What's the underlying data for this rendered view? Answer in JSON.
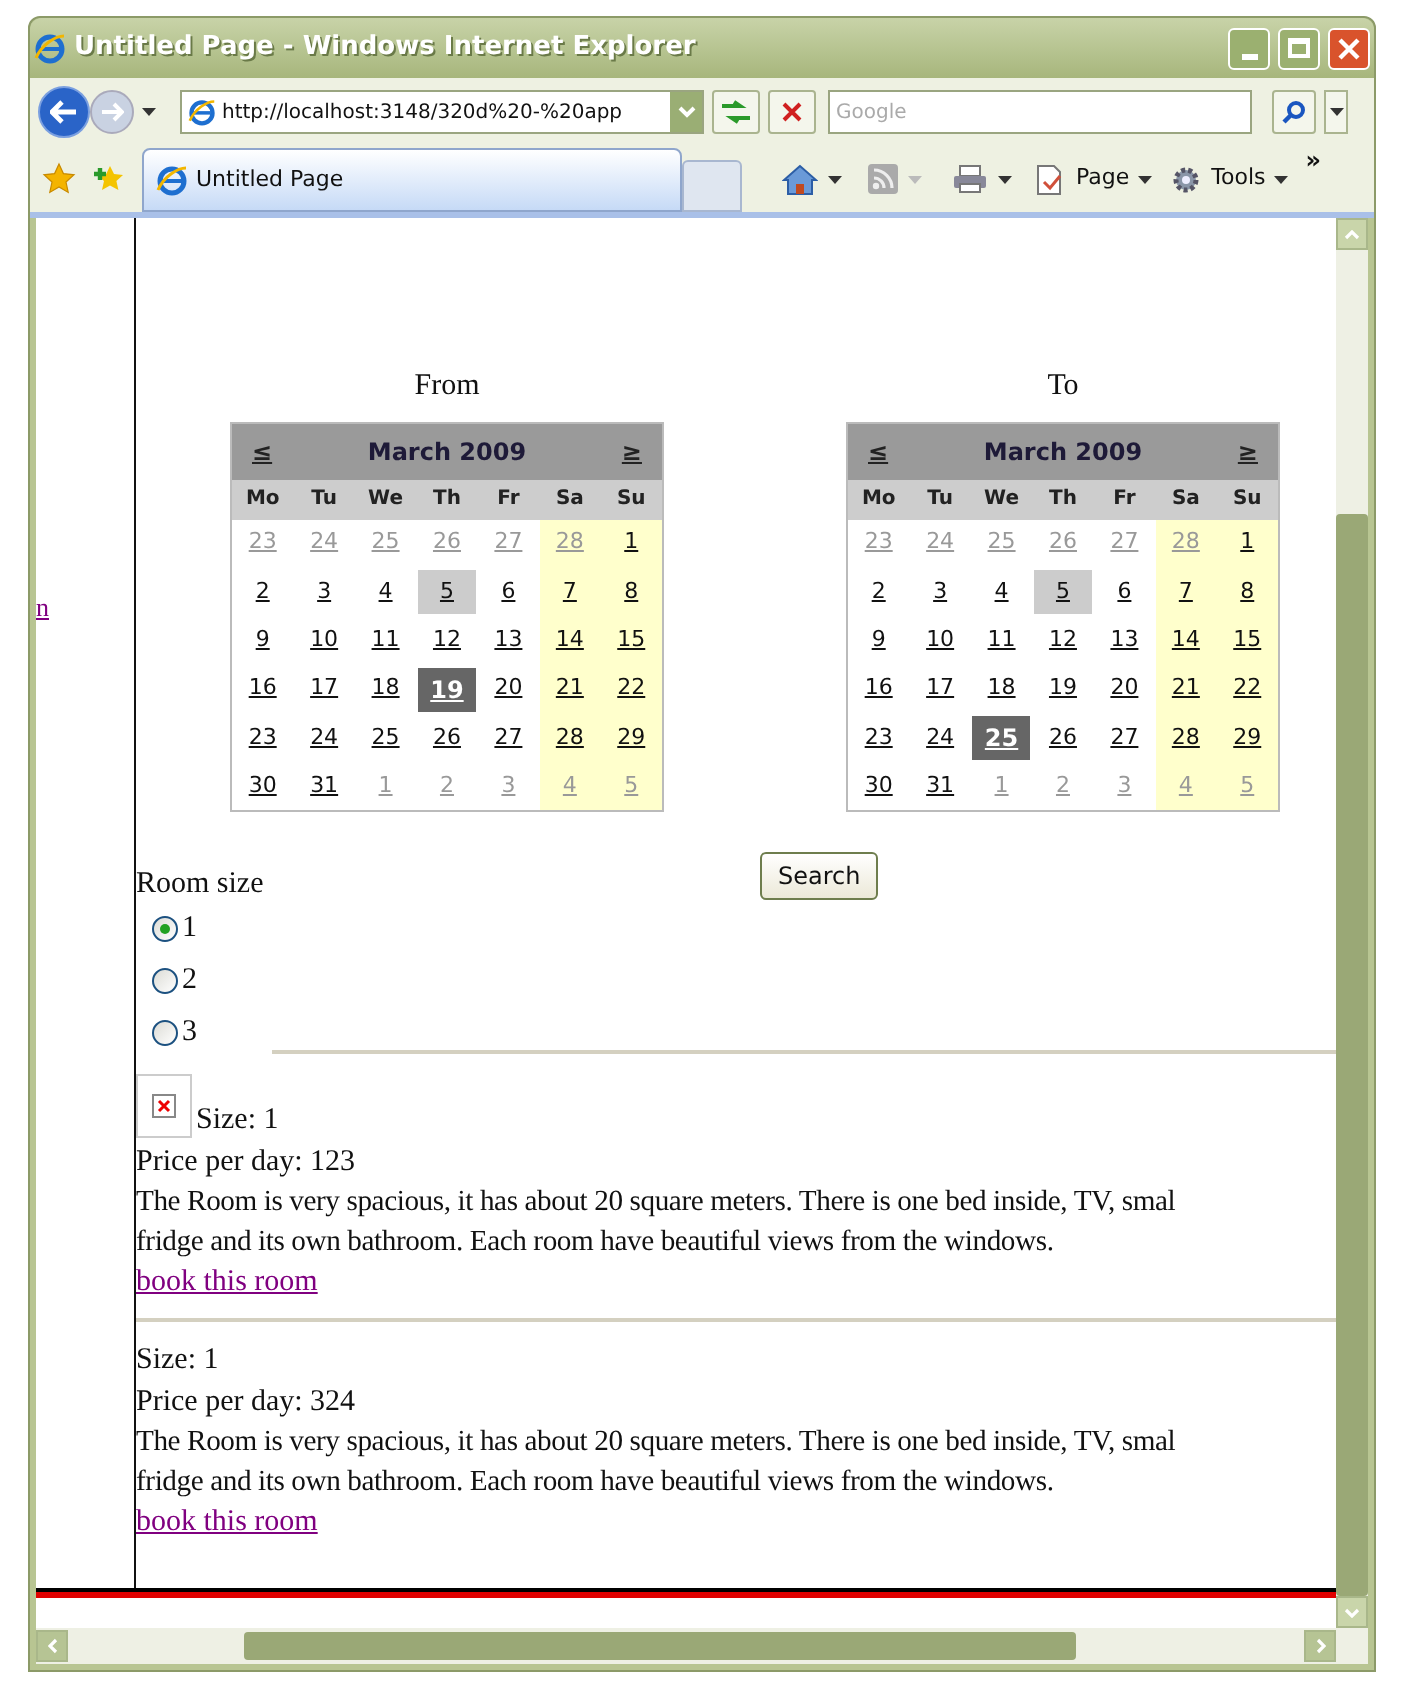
{
  "window": {
    "title": "Untitled Page - Windows Internet Explorer"
  },
  "address_bar": {
    "url": "http://localhost:3148/320d%20-%20app"
  },
  "search_box": {
    "placeholder": "Google"
  },
  "tabs": [
    {
      "label": "Untitled Page",
      "selected": true
    }
  ],
  "command_bar": {
    "items": [
      {
        "label": "Page"
      },
      {
        "label": "Tools"
      }
    ],
    "more": "»"
  },
  "left_nav": {
    "link": "n"
  },
  "calendars": [
    {
      "label": "From",
      "prev": "≤",
      "month": "March 2009",
      "next": "≥",
      "weekdays": [
        "Mo",
        "Tu",
        "We",
        "Th",
        "Fr",
        "Sa",
        "Su"
      ],
      "weeks": [
        [
          {
            "day": "23",
            "other_month": true,
            "today": false,
            "selected": false
          },
          {
            "day": "24",
            "other_month": true,
            "today": false,
            "selected": false
          },
          {
            "day": "25",
            "other_month": true,
            "today": false,
            "selected": false
          },
          {
            "day": "26",
            "other_month": true,
            "today": false,
            "selected": false
          },
          {
            "day": "27",
            "other_month": true,
            "today": false,
            "selected": false
          },
          {
            "day": "28",
            "other_month": true,
            "today": false,
            "selected": false
          },
          {
            "day": "1",
            "other_month": false,
            "today": false,
            "selected": false
          }
        ],
        [
          {
            "day": "2",
            "other_month": false,
            "today": false,
            "selected": false
          },
          {
            "day": "3",
            "other_month": false,
            "today": false,
            "selected": false
          },
          {
            "day": "4",
            "other_month": false,
            "today": false,
            "selected": false
          },
          {
            "day": "5",
            "other_month": false,
            "today": true,
            "selected": false
          },
          {
            "day": "6",
            "other_month": false,
            "today": false,
            "selected": false
          },
          {
            "day": "7",
            "other_month": false,
            "today": false,
            "selected": false
          },
          {
            "day": "8",
            "other_month": false,
            "today": false,
            "selected": false
          }
        ],
        [
          {
            "day": "9",
            "other_month": false,
            "today": false,
            "selected": false
          },
          {
            "day": "10",
            "other_month": false,
            "today": false,
            "selected": false
          },
          {
            "day": "11",
            "other_month": false,
            "today": false,
            "selected": false
          },
          {
            "day": "12",
            "other_month": false,
            "today": false,
            "selected": false
          },
          {
            "day": "13",
            "other_month": false,
            "today": false,
            "selected": false
          },
          {
            "day": "14",
            "other_month": false,
            "today": false,
            "selected": false
          },
          {
            "day": "15",
            "other_month": false,
            "today": false,
            "selected": false
          }
        ],
        [
          {
            "day": "16",
            "other_month": false,
            "today": false,
            "selected": false
          },
          {
            "day": "17",
            "other_month": false,
            "today": false,
            "selected": false
          },
          {
            "day": "18",
            "other_month": false,
            "today": false,
            "selected": false
          },
          {
            "day": "19",
            "other_month": false,
            "today": false,
            "selected": true
          },
          {
            "day": "20",
            "other_month": false,
            "today": false,
            "selected": false
          },
          {
            "day": "21",
            "other_month": false,
            "today": false,
            "selected": false
          },
          {
            "day": "22",
            "other_month": false,
            "today": false,
            "selected": false
          }
        ],
        [
          {
            "day": "23",
            "other_month": false,
            "today": false,
            "selected": false
          },
          {
            "day": "24",
            "other_month": false,
            "today": false,
            "selected": false
          },
          {
            "day": "25",
            "other_month": false,
            "today": false,
            "selected": false
          },
          {
            "day": "26",
            "other_month": false,
            "today": false,
            "selected": false
          },
          {
            "day": "27",
            "other_month": false,
            "today": false,
            "selected": false
          },
          {
            "day": "28",
            "other_month": false,
            "today": false,
            "selected": false
          },
          {
            "day": "29",
            "other_month": false,
            "today": false,
            "selected": false
          }
        ],
        [
          {
            "day": "30",
            "other_month": false,
            "today": false,
            "selected": false
          },
          {
            "day": "31",
            "other_month": false,
            "today": false,
            "selected": false
          },
          {
            "day": "1",
            "other_month": true,
            "today": false,
            "selected": false
          },
          {
            "day": "2",
            "other_month": true,
            "today": false,
            "selected": false
          },
          {
            "day": "3",
            "other_month": true,
            "today": false,
            "selected": false
          },
          {
            "day": "4",
            "other_month": true,
            "today": false,
            "selected": false
          },
          {
            "day": "5",
            "other_month": true,
            "today": false,
            "selected": false
          }
        ]
      ]
    },
    {
      "label": "To",
      "prev": "≤",
      "month": "March 2009",
      "next": "≥",
      "weekdays": [
        "Mo",
        "Tu",
        "We",
        "Th",
        "Fr",
        "Sa",
        "Su"
      ],
      "weeks": [
        [
          {
            "day": "23",
            "other_month": true,
            "today": false,
            "selected": false
          },
          {
            "day": "24",
            "other_month": true,
            "today": false,
            "selected": false
          },
          {
            "day": "25",
            "other_month": true,
            "today": false,
            "selected": false
          },
          {
            "day": "26",
            "other_month": true,
            "today": false,
            "selected": false
          },
          {
            "day": "27",
            "other_month": true,
            "today": false,
            "selected": false
          },
          {
            "day": "28",
            "other_month": true,
            "today": false,
            "selected": false
          },
          {
            "day": "1",
            "other_month": false,
            "today": false,
            "selected": false
          }
        ],
        [
          {
            "day": "2",
            "other_month": false,
            "today": false,
            "selected": false
          },
          {
            "day": "3",
            "other_month": false,
            "today": false,
            "selected": false
          },
          {
            "day": "4",
            "other_month": false,
            "today": false,
            "selected": false
          },
          {
            "day": "5",
            "other_month": false,
            "today": true,
            "selected": false
          },
          {
            "day": "6",
            "other_month": false,
            "today": false,
            "selected": false
          },
          {
            "day": "7",
            "other_month": false,
            "today": false,
            "selected": false
          },
          {
            "day": "8",
            "other_month": false,
            "today": false,
            "selected": false
          }
        ],
        [
          {
            "day": "9",
            "other_month": false,
            "today": false,
            "selected": false
          },
          {
            "day": "10",
            "other_month": false,
            "today": false,
            "selected": false
          },
          {
            "day": "11",
            "other_month": false,
            "today": false,
            "selected": false
          },
          {
            "day": "12",
            "other_month": false,
            "today": false,
            "selected": false
          },
          {
            "day": "13",
            "other_month": false,
            "today": false,
            "selected": false
          },
          {
            "day": "14",
            "other_month": false,
            "today": false,
            "selected": false
          },
          {
            "day": "15",
            "other_month": false,
            "today": false,
            "selected": false
          }
        ],
        [
          {
            "day": "16",
            "other_month": false,
            "today": false,
            "selected": false
          },
          {
            "day": "17",
            "other_month": false,
            "today": false,
            "selected": false
          },
          {
            "day": "18",
            "other_month": false,
            "today": false,
            "selected": false
          },
          {
            "day": "19",
            "other_month": false,
            "today": false,
            "selected": false
          },
          {
            "day": "20",
            "other_month": false,
            "today": false,
            "selected": false
          },
          {
            "day": "21",
            "other_month": false,
            "today": false,
            "selected": false
          },
          {
            "day": "22",
            "other_month": false,
            "today": false,
            "selected": false
          }
        ],
        [
          {
            "day": "23",
            "other_month": false,
            "today": false,
            "selected": false
          },
          {
            "day": "24",
            "other_month": false,
            "today": false,
            "selected": false
          },
          {
            "day": "25",
            "other_month": false,
            "today": false,
            "selected": true
          },
          {
            "day": "26",
            "other_month": false,
            "today": false,
            "selected": false
          },
          {
            "day": "27",
            "other_month": false,
            "today": false,
            "selected": false
          },
          {
            "day": "28",
            "other_month": false,
            "today": false,
            "selected": false
          },
          {
            "day": "29",
            "other_month": false,
            "today": false,
            "selected": false
          }
        ],
        [
          {
            "day": "30",
            "other_month": false,
            "today": false,
            "selected": false
          },
          {
            "day": "31",
            "other_month": false,
            "today": false,
            "selected": false
          },
          {
            "day": "1",
            "other_month": true,
            "today": false,
            "selected": false
          },
          {
            "day": "2",
            "other_month": true,
            "today": false,
            "selected": false
          },
          {
            "day": "3",
            "other_month": true,
            "today": false,
            "selected": false
          },
          {
            "day": "4",
            "other_month": true,
            "today": false,
            "selected": false
          },
          {
            "day": "5",
            "other_month": true,
            "today": false,
            "selected": false
          }
        ]
      ]
    }
  ],
  "room_size": {
    "label": "Room size",
    "options": [
      {
        "label": "1",
        "selected": true
      },
      {
        "label": "2",
        "selected": false
      },
      {
        "label": "3",
        "selected": false
      }
    ]
  },
  "search_button": {
    "label": "Search"
  },
  "rooms": [
    {
      "has_image": true,
      "size": "Size: 1",
      "price": "Price per day: 123",
      "description_lines": [
        "The Room is very spacious, it has about 20 square meters. There is one bed inside, TV, smal",
        "fridge and its own bathroom. Each room have beautiful views from the windows."
      ],
      "link": "book this room"
    },
    {
      "has_image": false,
      "size": "Size: 1",
      "price": "Price per day: 324",
      "description_lines": [
        "The Room is very spacious, it has about 20 square meters. There is one bed inside, TV, smal",
        "fridge and its own bathroom. Each room have beautiful views from the windows."
      ],
      "link": "book this room"
    }
  ]
}
